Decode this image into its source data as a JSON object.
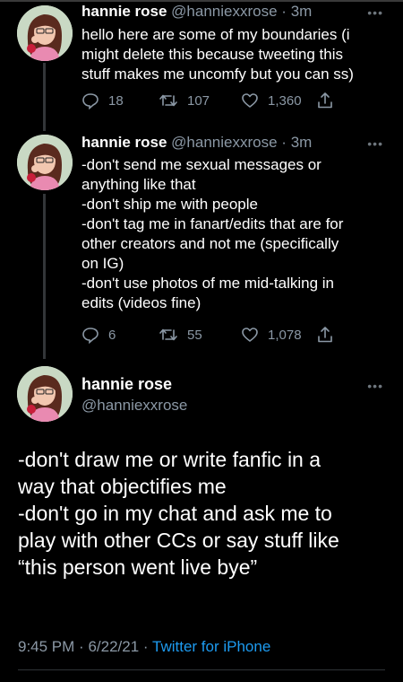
{
  "tweets": [
    {
      "name": "hannie rose",
      "handle": "@hanniexxrose",
      "separator": "·",
      "time": "3m",
      "text": "hello here are some of my boundaries (i\nmight delete this because tweeting this\nstuff makes me uncomfy but you can ss)",
      "replies": "18",
      "retweets": "107",
      "likes": "1,360",
      "more_label": "•••"
    },
    {
      "name": "hannie rose",
      "handle": "@hanniexxrose",
      "separator": "·",
      "time": "3m",
      "text": "-don't send me sexual messages or\nanything like that\n-don't ship me with people\n-don't tag me in fanart/edits that are for\nother creators and not me (specifically\non IG)\n-don't use photos of me mid-talking in\nedits (videos fine)",
      "replies": "6",
      "retweets": "55",
      "likes": "1,078",
      "more_label": "•••"
    }
  ],
  "main_tweet": {
    "name": "hannie rose",
    "handle": "@hanniexxrose",
    "more_label": "•••",
    "text": "-don't draw me or write fanfic in a\nway that objectifies me\n-don't go in my chat and ask me to\nplay with other CCs or say stuff like\n“this person went live bye”",
    "time": "9:45 PM",
    "separator": "·",
    "date": "6/22/21",
    "source": "Twitter for iPhone"
  },
  "icons": {
    "reply": "reply-icon",
    "retweet": "retweet-icon",
    "like": "heart-icon",
    "share": "share-icon",
    "more": "more-options-icon"
  },
  "colors": {
    "background": "#000000",
    "text": "#ffffff",
    "secondary": "#8b98a5",
    "link": "#1d9bf0"
  }
}
